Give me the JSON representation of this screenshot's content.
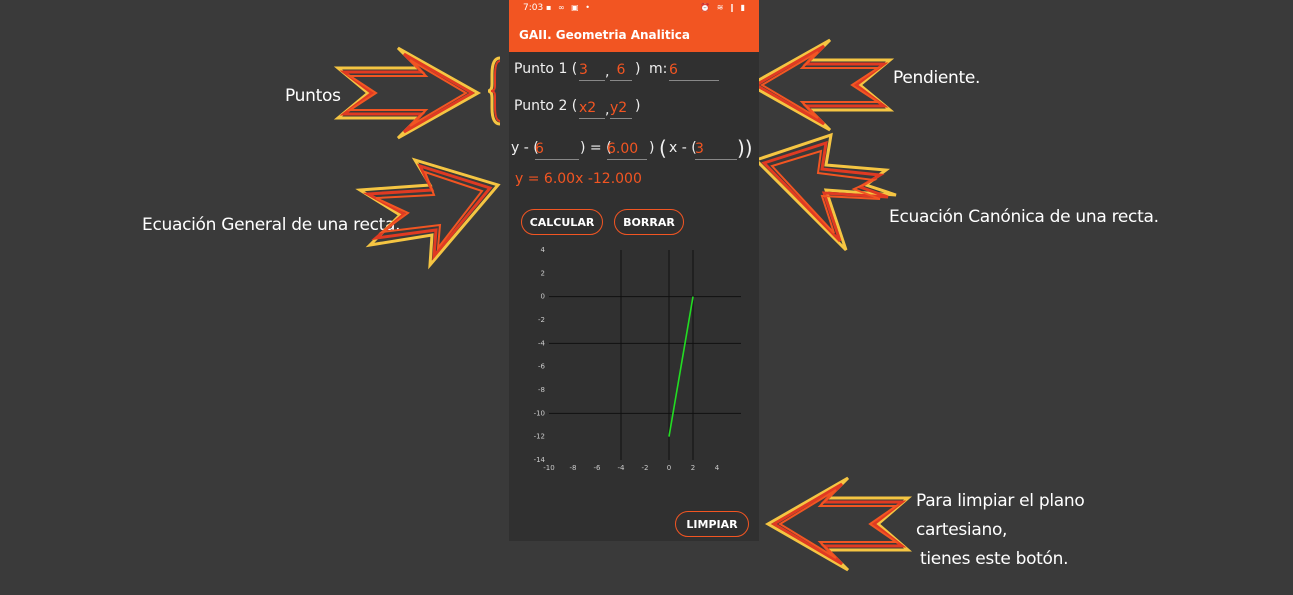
{
  "status_bar": {
    "time": "7:03"
  },
  "app_title": "GAII. Geometria Analitica",
  "point1": {
    "label": "Punto 1 (",
    "x": "3",
    "comma": ",",
    "y": "6",
    "close": ")",
    "m_label": "m:",
    "m": "6"
  },
  "point2": {
    "label": "Punto 2 (",
    "x_placeholder": "x2",
    "comma": ",",
    "y_placeholder": "y2",
    "close": ")"
  },
  "canonical": {
    "y_label": "y - (",
    "y1": "6",
    "eq": ") = (",
    "m": "6.00",
    "close1": ")",
    "open2": "(",
    "x_label": "x - (",
    "x1": "3",
    "close2": "))"
  },
  "result": "y = 6.00x -12.000",
  "buttons": {
    "calcular": "CALCULAR",
    "borrar": "BORRAR",
    "limpiar": "LIMPIAR"
  },
  "annotations": {
    "puntos": "Puntos",
    "pendiente": "Pendiente.",
    "general": "Ecuación General de una recta.",
    "canonica": "Ecuación Canónica de una recta.",
    "limpiar_line1": "Para limpiar el plano cartesiano,",
    "limpiar_line2": "tienes este botón."
  },
  "chart_data": {
    "type": "line",
    "x_ticks": [
      "-10",
      "-8",
      "-6",
      "-4",
      "-2",
      "0",
      "2",
      "4"
    ],
    "y_ticks": [
      "4",
      "2",
      "0",
      "-2",
      "-4",
      "-6",
      "-8",
      "-10",
      "-12",
      "-14"
    ],
    "xlim": [
      -10,
      6
    ],
    "ylim": [
      -14,
      4
    ],
    "series": [
      {
        "x": [
          0,
          2
        ],
        "y": [
          -12,
          0
        ],
        "color": "#22dd22"
      }
    ],
    "grid_lines_x": [
      -4,
      0,
      2
    ],
    "grid_lines_y": [
      0,
      -4,
      -10
    ],
    "axes_color": "#111111"
  }
}
